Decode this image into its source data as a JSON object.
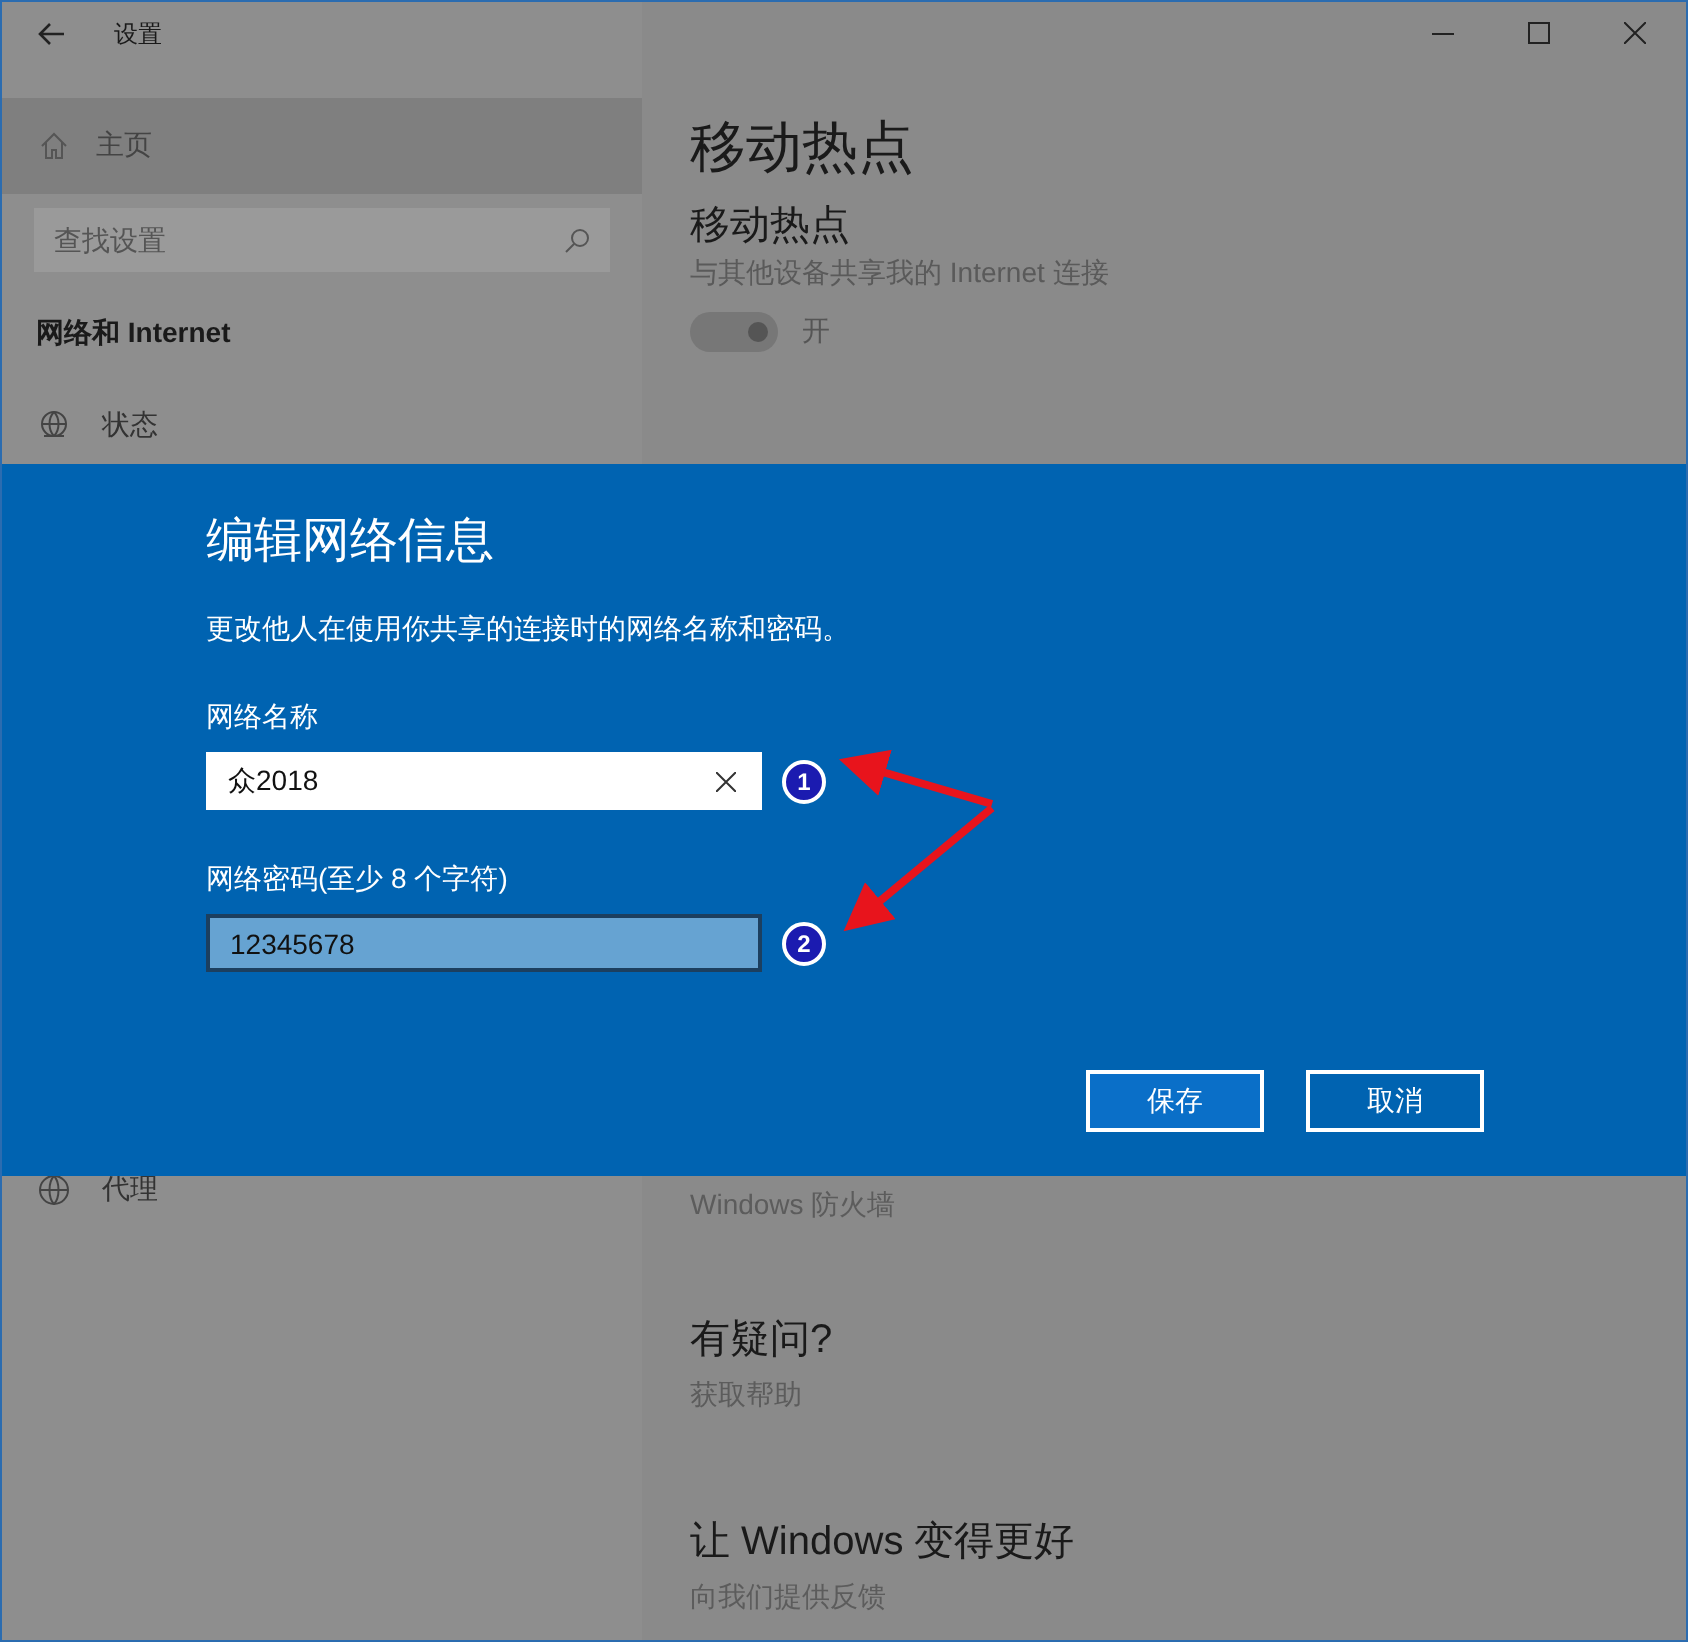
{
  "window": {
    "title": "设置"
  },
  "sidebar": {
    "home": {
      "label": "主页",
      "selected": true
    },
    "search": {
      "placeholder": "查找设置"
    },
    "section": "网络和 Internet",
    "status_item": "状态",
    "proxy_item": "代理"
  },
  "main": {
    "page_title": "移动热点",
    "hotspot": {
      "heading": "移动热点",
      "description": "与其他设备共享我的 Internet 连接",
      "toggle": {
        "on": true,
        "label": "开"
      }
    },
    "firewall_link": "Windows 防火墙",
    "help": {
      "heading": "有疑问?",
      "link": "获取帮助"
    },
    "feedback": {
      "heading": "让 Windows 变得更好",
      "link": "向我们提供反馈"
    }
  },
  "dialog": {
    "title": "编辑网络信息",
    "description": "更改他人在使用你共享的连接时的网络名称和密码。",
    "fields": [
      {
        "label": "网络名称",
        "value": "众2018",
        "focused": true
      },
      {
        "label": "网络密码(至少 8 个字符)",
        "value": "12345678",
        "focused": false
      }
    ],
    "buttons": [
      {
        "label": "保存",
        "primary": true
      },
      {
        "label": "取消",
        "primary": false
      }
    ]
  },
  "annotations": [
    {
      "number": "1"
    },
    {
      "number": "2"
    }
  ]
}
